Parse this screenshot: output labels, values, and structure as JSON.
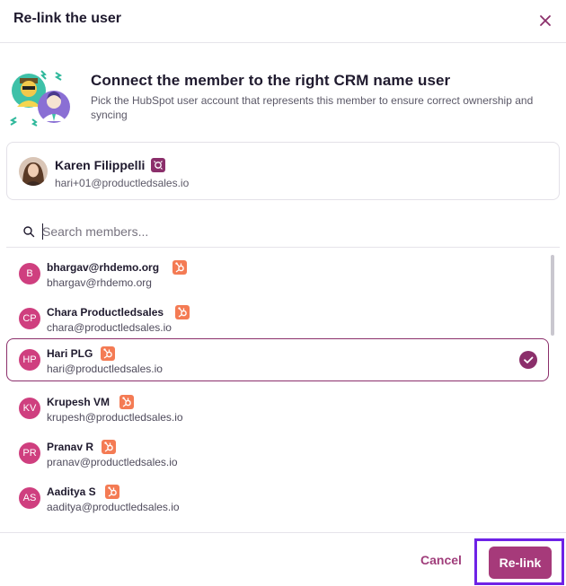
{
  "header": {
    "title": "Re-link the user"
  },
  "intro": {
    "title": "Connect the member to the right CRM name user",
    "description": "Pick the HubSpot user account that represents this member to ensure correct ownership and syncing"
  },
  "member": {
    "name": "Karen Filippelli",
    "email": "hari+01@productledsales.io",
    "badge_icon": "crm-badge-icon"
  },
  "search": {
    "placeholder": "Search members...",
    "value": ""
  },
  "users": [
    {
      "initials": "B",
      "name": "bhargav@rhdemo.org",
      "email": "bhargav@rhdemo.org",
      "selected": false
    },
    {
      "initials": "CP",
      "name": "Chara Productledsales",
      "email": "chara@productledsales.io",
      "selected": false
    },
    {
      "initials": "HP",
      "name": "Hari PLG",
      "email": "hari@productledsales.io",
      "selected": true
    },
    {
      "initials": "KV",
      "name": "Krupesh VM",
      "email": "krupesh@productledsales.io",
      "selected": false
    },
    {
      "initials": "PR",
      "name": "Pranav R",
      "email": "pranav@productledsales.io",
      "selected": false
    },
    {
      "initials": "AS",
      "name": "Aaditya S",
      "email": "aaditya@productledsales.io",
      "selected": false
    }
  ],
  "footer": {
    "cancel_label": "Cancel",
    "relink_label": "Re-link"
  },
  "colors": {
    "accent": "#a63a7a",
    "avatar": "#cf3f7f",
    "hubspot": "#f47b54",
    "highlight": "#6e22e6"
  }
}
